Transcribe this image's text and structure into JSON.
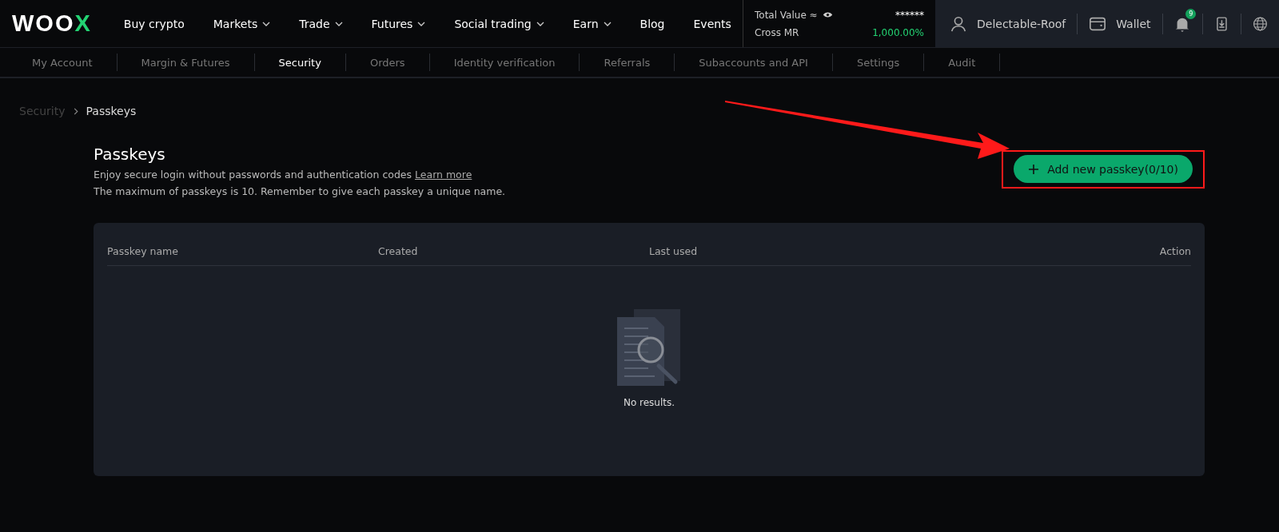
{
  "logo": {
    "text": "WOO",
    "accent": "X"
  },
  "nav": [
    {
      "label": "Buy crypto",
      "has_menu": false
    },
    {
      "label": "Markets",
      "has_menu": true
    },
    {
      "label": "Trade",
      "has_menu": true
    },
    {
      "label": "Futures",
      "has_menu": true
    },
    {
      "label": "Social trading",
      "has_menu": true
    },
    {
      "label": "Earn",
      "has_menu": true
    },
    {
      "label": "Blog",
      "has_menu": false
    },
    {
      "label": "Events",
      "has_menu": false
    }
  ],
  "balance": {
    "total_label": "Total Value ≈",
    "total_value": "******",
    "mr_label": "Cross MR",
    "mr_value": "1,000.00%"
  },
  "account": {
    "username": "Delectable-Roof",
    "wallet": "Wallet",
    "notification_count": "9"
  },
  "subnav": [
    {
      "label": "My Account",
      "selected": false
    },
    {
      "label": "Margin & Futures",
      "selected": false
    },
    {
      "label": "Security",
      "selected": true
    },
    {
      "label": "Orders",
      "selected": false
    },
    {
      "label": "Identity verification",
      "selected": false
    },
    {
      "label": "Referrals",
      "selected": false
    },
    {
      "label": "Subaccounts and API",
      "selected": false
    },
    {
      "label": "Settings",
      "selected": false
    },
    {
      "label": "Audit",
      "selected": false
    }
  ],
  "breadcrumb": [
    "Security",
    "Passkeys"
  ],
  "heading": "Passkeys",
  "description": "Enjoy secure login without passwords and authentication codes",
  "learn_more": "Learn more",
  "note": "The maximum of passkeys is 10. Remember to give each passkey a unique name.",
  "add_button": "Add new passkey(0/10)",
  "table": {
    "columns": [
      {
        "label": "Passkey name"
      },
      {
        "label": "Created"
      },
      {
        "label": "Last used"
      },
      {
        "label": "Action"
      }
    ],
    "empty_text": "No results."
  }
}
